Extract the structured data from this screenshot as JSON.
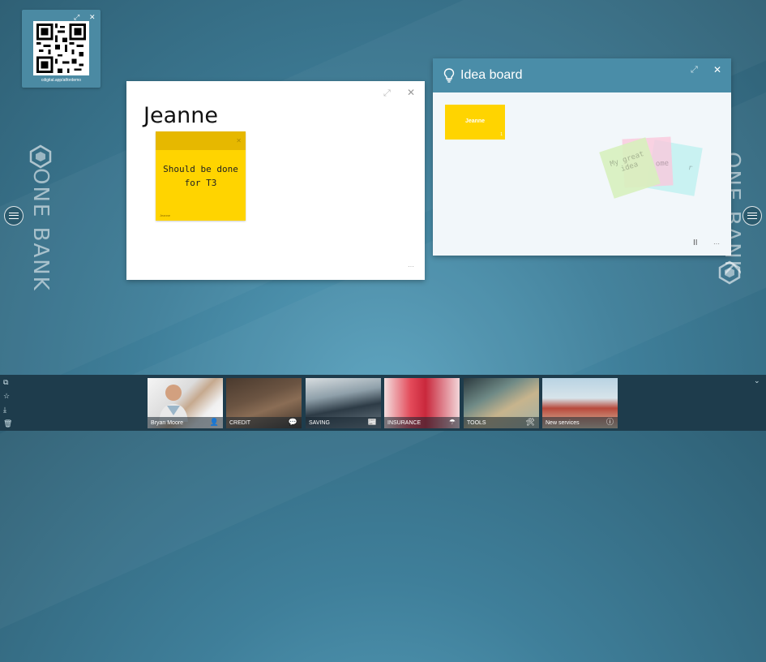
{
  "brand": {
    "left_text": "ONE BANK",
    "right_text": "ONE BANK"
  },
  "qr": {
    "caption": "cdigital.app/atfordemo"
  },
  "note_window": {
    "title": "Jeanne",
    "postit": {
      "text": "Should be done for T3",
      "author": "Jeanne"
    },
    "more_label": "···"
  },
  "idea_board": {
    "title": "Idea board",
    "tile": {
      "name": "Jeanne",
      "count": "1"
    },
    "ghost_notes": [
      "My great idea",
      "ome",
      "r"
    ],
    "pause_label": "II",
    "more_label": "···"
  },
  "taskbar": {
    "tiles": [
      {
        "label": "Bryan Moore",
        "icon": "person-icon"
      },
      {
        "label": "CREDIT",
        "icon": "chat-icon"
      },
      {
        "label": "SAVING",
        "icon": "newspaper-icon"
      },
      {
        "label": "INSURANCE",
        "icon": "umbrella-icon"
      },
      {
        "label": "TOOLS",
        "icon": "tools-icon"
      },
      {
        "label": "New services",
        "icon": "info-icon"
      }
    ]
  },
  "colors": {
    "note_yellow": "#ffd400",
    "header_blue": "#4a8da8",
    "taskbar": "#1e3c4c"
  }
}
